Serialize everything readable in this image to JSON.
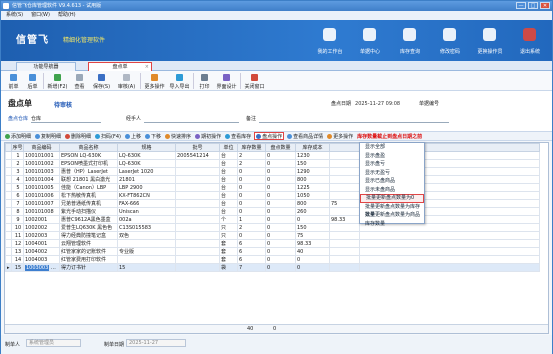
{
  "window": {
    "title": "信管飞仓库管理软件 V9.4.613 - 试用版",
    "btn_min": "—",
    "btn_max": "□",
    "btn_close": "✕"
  },
  "menu": [
    "系统(S)",
    "窗口(W)",
    "帮助(H)"
  ],
  "brand": {
    "logo": "信管飞",
    "tagline": "精细化管理软件"
  },
  "topnav": [
    {
      "label": "我的工作台",
      "icon": "desk-icon"
    },
    {
      "label": "单据中心",
      "icon": "doc-icon"
    },
    {
      "label": "库存查询",
      "icon": "stock-icon"
    },
    {
      "label": "修改密码",
      "icon": "lock-icon"
    },
    {
      "label": "更换操作员",
      "icon": "user-icon"
    },
    {
      "label": "退出系统",
      "icon": "power-icon"
    }
  ],
  "tabs": [
    {
      "label": "功能导航器"
    },
    {
      "label": "盘点单"
    }
  ],
  "toolbar": [
    {
      "label": "前单",
      "icon": "prev-icon",
      "color": "#4a90d9"
    },
    {
      "label": "后单",
      "icon": "next-icon",
      "color": "#4a90d9"
    },
    {
      "label": "新增(F2)",
      "icon": "add-icon",
      "color": "#3fa34d"
    },
    {
      "label": "查看",
      "icon": "view-icon",
      "color": "#9aa8b8"
    },
    {
      "label": "保存(S)",
      "icon": "save-icon",
      "color": "#3a6fc4"
    },
    {
      "label": "审核(A)",
      "icon": "audit-icon",
      "color": "#b0b8c4"
    },
    {
      "label": "更多操作",
      "icon": "more-icon",
      "color": "#e08a2a"
    },
    {
      "label": "导入导出",
      "icon": "import-icon",
      "color": "#2d9bd6"
    },
    {
      "label": "打印",
      "icon": "print-icon",
      "color": "#6b7d90"
    },
    {
      "label": "界面设计",
      "icon": "design-icon",
      "color": "#7a62c4"
    },
    {
      "label": "关闭窗口",
      "icon": "close-icon",
      "color": "#d24a3a"
    }
  ],
  "form": {
    "title": "盘点单",
    "subtitle": "待审核",
    "date_label": "盘点日期",
    "date_value": "2025-11-27 09:08",
    "no_label": "单据编号",
    "warehouse_label": "盘点仓库",
    "warehouse_value": "仓库",
    "handler_label": "经手人",
    "note_label": "备注"
  },
  "actions": [
    {
      "label": "添加明细",
      "color": "#3fa34d"
    },
    {
      "label": "复制明细",
      "color": "#4a90d9"
    },
    {
      "label": "删除明细",
      "color": "#d24a3a"
    },
    {
      "label": "扫码(F4)",
      "color": "#2d9bd6"
    },
    {
      "label": "上移",
      "color": "#4a90d9"
    },
    {
      "label": "下移",
      "color": "#4a90d9"
    },
    {
      "label": "快速排序",
      "color": "#e08a2a"
    },
    {
      "label": "期初操作",
      "color": "#7a62c4"
    },
    {
      "label": "查看库存",
      "color": "#2d9bd6"
    },
    {
      "label": "盘点操作",
      "color": "#3a6fc4"
    },
    {
      "label": "查看商品详情",
      "color": "#4a90d9"
    },
    {
      "label": "更多操作",
      "color": "#e08a2a"
    }
  ],
  "warn": "库存数量截止到盘点日期之前",
  "columns": [
    "序号",
    "商品编码",
    "商品名称",
    "规格",
    "批号",
    "单位",
    "库存数量",
    "盘点数量",
    "库存成本"
  ],
  "rows": [
    [
      "1",
      "100101001",
      "EPSON LQ-630K",
      "LQ-630K",
      "2005541214",
      "台",
      "2",
      "0",
      "1230"
    ],
    [
      "2",
      "100101002",
      "EPSON喷墨式打印机",
      "LQ-630K",
      "",
      "台",
      "2",
      "0",
      "150"
    ],
    [
      "3",
      "100101003",
      "惠普（HP）LaserJet",
      "LaserJet 1020",
      "",
      "台",
      "0",
      "0",
      "1290"
    ],
    [
      "4",
      "100101004",
      "联想 21801 黑白激光",
      "21801",
      "",
      "台",
      "0",
      "0",
      "800"
    ],
    [
      "5",
      "100101005",
      "佳能（Canon）LBP",
      "LBP 2900",
      "",
      "台",
      "0",
      "0",
      "1225"
    ],
    [
      "6",
      "100101006",
      "松下热敏传真机",
      "KX-FT862CN",
      "",
      "台",
      "0",
      "0",
      "1050"
    ],
    [
      "7",
      "100101007",
      "兄弟普通纸传真机",
      "FAX-666",
      "",
      "台",
      "0",
      "0",
      "800"
    ],
    [
      "8",
      "100101008",
      "紫光手动扫描仪",
      "Uniscan",
      "",
      "台",
      "0",
      "0",
      "260"
    ],
    [
      "9",
      "1002001",
      "惠普C9612A黑色墨盒",
      "002a",
      "",
      "个",
      "1",
      "0",
      "0"
    ],
    [
      "10",
      "1002002",
      "爱普生LQ630K 黑色色",
      "C13S015583",
      "",
      "只",
      "2",
      "0",
      "150"
    ],
    [
      "11",
      "1002003",
      "得力经典防撞笔记盒",
      "双色",
      "",
      "只",
      "0",
      "0",
      "75"
    ],
    [
      "12",
      "1004001",
      "云翔管理软件",
      "",
      "",
      "套",
      "6",
      "0",
      "98.33"
    ],
    [
      "13",
      "1004002",
      "红管家家的记账软件",
      "专业版",
      "",
      "套",
      "6",
      "0",
      "40"
    ],
    [
      "14",
      "1004003",
      "红管家费用打印软件",
      "",
      "",
      "套",
      "6",
      "0",
      "0"
    ],
    [
      "15",
      "1003003",
      "得力订书针",
      "15",
      "",
      "袋",
      "7",
      "0",
      "0"
    ]
  ],
  "extra_col": [
    "",
    "",
    "",
    "",
    "",
    "",
    "75",
    "",
    "98.33",
    "",
    "",
    "",
    "",
    "",
    ""
  ],
  "total": {
    "qty": "40",
    "count": "0"
  },
  "dropdown": [
    "显示全部",
    "显示盘盈",
    "显示盘亏",
    "显示无盈亏",
    "显示已盘商品",
    "显示未盘商品",
    "批量更新盘点数量为0",
    "批量更新盘点数量为库存数量",
    "批量更新盘点数量为商品库存数量"
  ],
  "footer": {
    "maker_label": "制单人",
    "maker_value": "系统管理员",
    "date_label": "制单日期",
    "date_value": "2025-11-27"
  }
}
